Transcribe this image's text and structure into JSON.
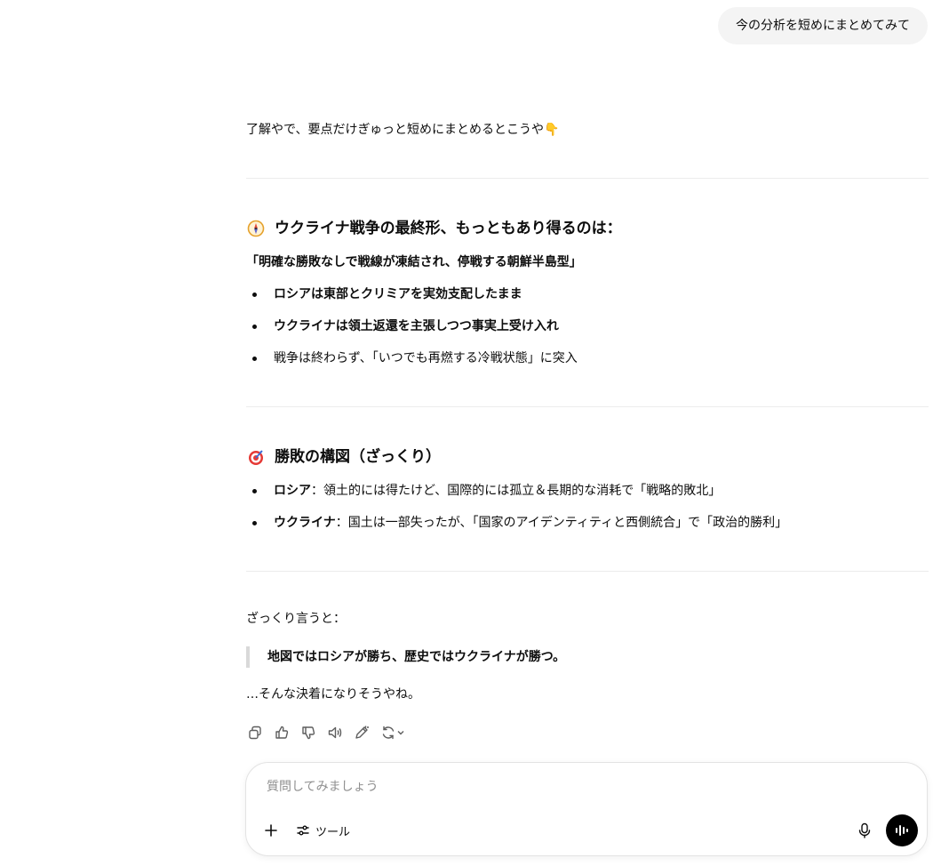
{
  "user_message": "今の分析を短めにまとめてみて",
  "assistant": {
    "intro": "了解やで、要点だけぎゅっと短めにまとめるとこうや👇",
    "section1": {
      "icon": "compass-emoji",
      "title": "ウクライナ戦争の最終形、もっともあり得るのは：",
      "subtitle": "「明確な勝敗なしで戦線が凍結され、停戦する朝鮮半島型」",
      "bullets": [
        {
          "bold": "ロシアは東部とクリミアを実効支配したまま",
          "text": ""
        },
        {
          "bold": "ウクライナは領土返還を主張しつつ事実上受け入れ",
          "text": ""
        },
        {
          "bold": "",
          "text": "戦争は終わらず、「いつでも再燃する冷戦状態」に突入"
        }
      ]
    },
    "section2": {
      "icon": "target-emoji",
      "title": "勝敗の構図（ざっくり）",
      "bullets": [
        {
          "bold": "ロシア",
          "text": "：領土的には得たけど、国際的には孤立＆長期的な消耗で「戦略的敗北」"
        },
        {
          "bold": "ウクライナ",
          "text": "：国土は一部失ったが、「国家のアイデンティティと西側統合」で「政治的勝利」"
        }
      ]
    },
    "summary_lead": "ざっくり言うと：",
    "quote": "地図ではロシアが勝ち、歴史ではウクライナが勝つ。",
    "closing": "…そんな決着になりそうやね。"
  },
  "composer": {
    "placeholder": "質問してみましょう",
    "tools_label": "ツール"
  },
  "colors": {
    "background": "#ffffff",
    "bubble": "#f4f4f4",
    "text": "#0d0d0d",
    "muted": "#8f8f8f",
    "voice_button": "#000000"
  }
}
